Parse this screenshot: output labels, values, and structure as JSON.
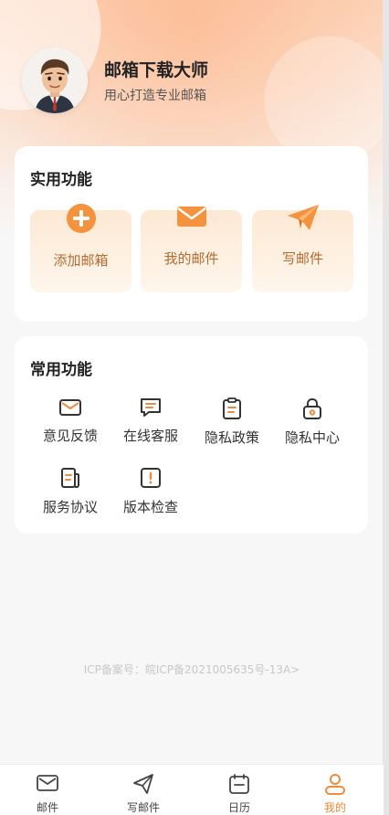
{
  "header": {
    "app_name": "邮箱下载大师",
    "tagline": "用心打造专业邮箱"
  },
  "practical": {
    "title": "实用功能",
    "tiles": [
      {
        "label": "添加邮箱",
        "icon": "plus-circle-icon"
      },
      {
        "label": "我的邮件",
        "icon": "envelope-icon"
      },
      {
        "label": "写邮件",
        "icon": "paper-plane-icon"
      }
    ]
  },
  "common": {
    "title": "常用功能",
    "items": [
      {
        "label": "意见反馈",
        "icon": "mail-icon"
      },
      {
        "label": "在线客服",
        "icon": "chat-icon"
      },
      {
        "label": "隐私政策",
        "icon": "clipboard-icon"
      },
      {
        "label": "隐私中心",
        "icon": "lock-icon"
      },
      {
        "label": "服务协议",
        "icon": "document-icon"
      },
      {
        "label": "版本检查",
        "icon": "alert-icon"
      }
    ]
  },
  "footer": {
    "icp": "ICP备案号：皖ICP备2021005635号-13A>"
  },
  "tabbar": {
    "tabs": [
      {
        "label": "邮件",
        "icon": "mail-icon"
      },
      {
        "label": "写邮件",
        "icon": "send-icon"
      },
      {
        "label": "日历",
        "icon": "calendar-icon"
      },
      {
        "label": "我的",
        "icon": "user-icon",
        "active": true
      }
    ]
  },
  "colors": {
    "accent": "#f08a3c",
    "tile_text": "#b36b32"
  }
}
